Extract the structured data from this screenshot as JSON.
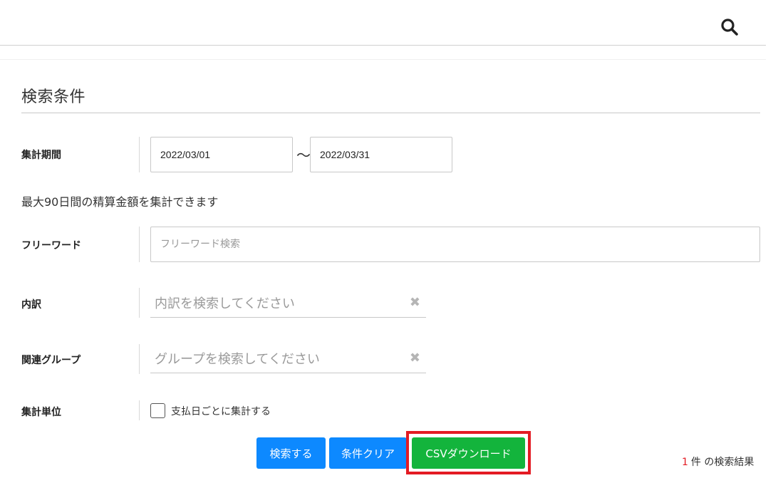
{
  "header": {
    "search_icon": "search-icon"
  },
  "search": {
    "title": "検索条件",
    "period": {
      "label": "集計期間",
      "from": "2022/03/01",
      "separator": "〜",
      "to": "2022/03/31"
    },
    "note": "最大90日間の精算金額を集計できます",
    "freeword": {
      "label": "フリーワード",
      "placeholder": "フリーワード検索"
    },
    "breakdown": {
      "label": "内訳",
      "placeholder": "内訳を検索してください",
      "clear": "✖"
    },
    "group": {
      "label": "関連グループ",
      "placeholder": "グループを検索してください",
      "clear": "✖"
    },
    "unit": {
      "label": "集計単位",
      "checkbox_label": "支払日ごとに集計する",
      "checked": false
    }
  },
  "buttons": {
    "search": "検索する",
    "clear": "条件クリア",
    "csv": "CSVダウンロード"
  },
  "result": {
    "count": "1",
    "suffix": "件 の検索結果"
  },
  "colors": {
    "primary": "#0d89ff",
    "csv": "#13b43c",
    "highlight": "#e31b23"
  }
}
